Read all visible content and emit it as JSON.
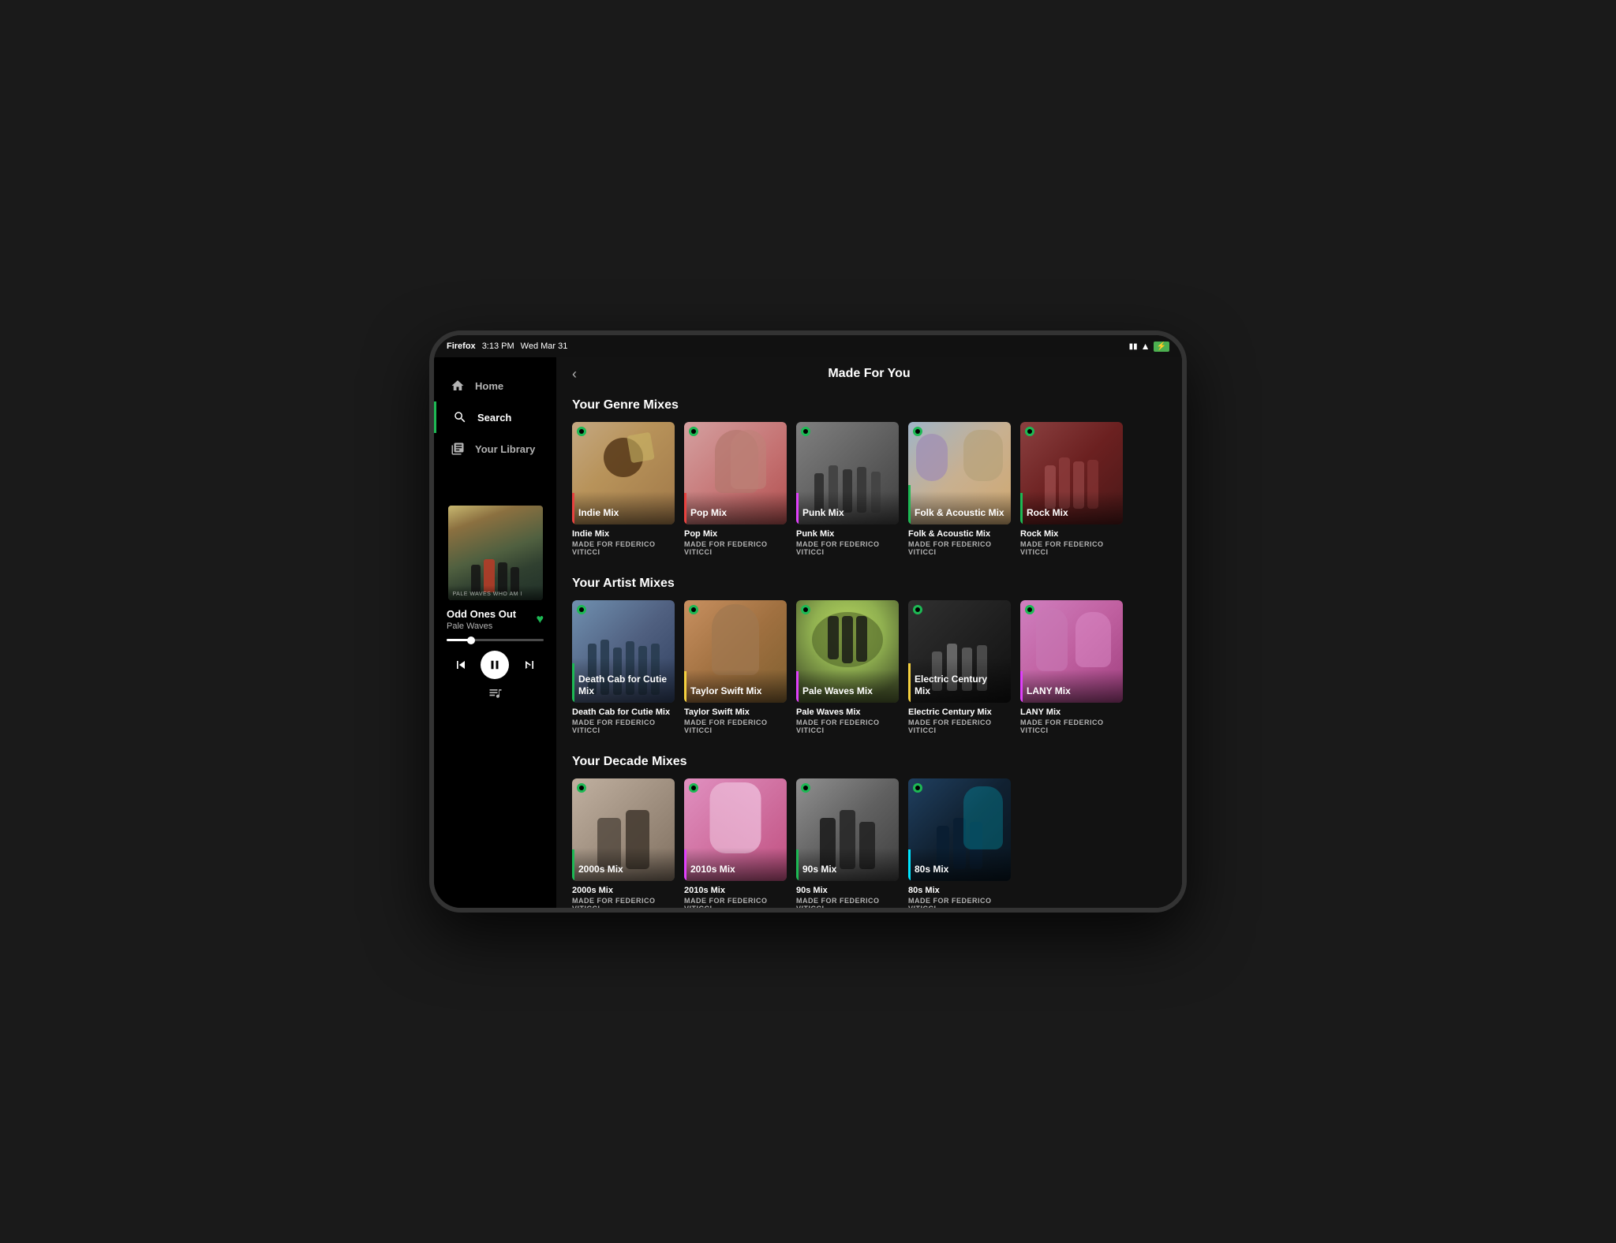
{
  "statusBar": {
    "browser": "Firefox",
    "time": "3:13 PM",
    "date": "Wed Mar 31"
  },
  "nav": {
    "home": "Home",
    "search": "Search",
    "yourLibrary": "Your Library"
  },
  "player": {
    "trackName": "Odd Ones Out",
    "artist": "Pale Waves",
    "albumLabel": "PALE WAVES WHO AM I",
    "progress": 25
  },
  "pageTitle": "Made For You",
  "sections": [
    {
      "id": "genre-mixes",
      "title": "Your Genre Mixes",
      "cards": [
        {
          "id": "indie-mix",
          "label": "Indie Mix",
          "title": "Indie Mix",
          "subtitle": "MADE FOR FEDERICO VITICCI",
          "accentColor": "#e8423f",
          "bg1": "#c4a882",
          "bg2": "#b8935a"
        },
        {
          "id": "pop-mix",
          "label": "Pop Mix",
          "title": "Pop Mix",
          "subtitle": "MADE FOR FEDERICO VITICCI",
          "accentColor": "#e8423f",
          "bg1": "#d4a0a0",
          "bg2": "#c47070"
        },
        {
          "id": "punk-mix",
          "label": "Punk Mix",
          "title": "Punk Mix",
          "subtitle": "MADE FOR FEDERICO VITICCI",
          "accentColor": "#e040fb",
          "bg1": "#808080",
          "bg2": "#606060"
        },
        {
          "id": "folk-mix",
          "label": "Folk & Acoustic Mix",
          "title": "Folk & Acoustic Mix",
          "subtitle": "MADE FOR FEDERICO VITICCI",
          "accentColor": "#1db954",
          "bg1": "#a0b4c8",
          "bg2": "#c8b090"
        },
        {
          "id": "rock-mix",
          "label": "Rock Mix",
          "title": "Rock Mix",
          "subtitle": "MADE FOR FEDERICO VITICCI",
          "accentColor": "#1db954",
          "bg1": "#8b4040",
          "bg2": "#6b2020"
        }
      ]
    },
    {
      "id": "artist-mixes",
      "title": "Your Artist Mixes",
      "cards": [
        {
          "id": "dcfc-mix",
          "label": "Death Cab for Cutie Mix",
          "title": "Death Cab for Cutie Mix",
          "subtitle": "MADE FOR FEDERICO VITICCI",
          "accentColor": "#1db954",
          "bg1": "#7090b0",
          "bg2": "#506080"
        },
        {
          "id": "swift-mix",
          "label": "Taylor Swift Mix",
          "title": "Taylor Swift Mix",
          "subtitle": "MADE FOR FEDERICO VITICCI",
          "accentColor": "#f4d03f",
          "bg1": "#c89060",
          "bg2": "#a07040"
        },
        {
          "id": "pale-waves-mix",
          "label": "Pale Waves Mix",
          "title": "Pale Waves Mix",
          "subtitle": "MADE FOR FEDERICO VITICCI",
          "accentColor": "#e040fb",
          "bg1": "#90b050",
          "bg2": "#506030"
        },
        {
          "id": "electric-century-mix",
          "label": "Electric Century Mix",
          "title": "Electric Century Mix",
          "subtitle": "MADE FOR FEDERICO VITICCI",
          "accentColor": "#f4d03f",
          "bg1": "#303030",
          "bg2": "#202020"
        },
        {
          "id": "lany-mix",
          "label": "LANY Mix",
          "title": "LANY Mix",
          "subtitle": "MADE FOR FEDERICO VITICCI",
          "accentColor": "#e040fb",
          "bg1": "#d080c0",
          "bg2": "#c060a0"
        }
      ]
    },
    {
      "id": "decade-mixes",
      "title": "Your Decade Mixes",
      "cards": [
        {
          "id": "2000s-mix",
          "label": "2000s Mix",
          "title": "2000s Mix",
          "subtitle": "MADE FOR FEDERICO VITICCI",
          "accentColor": "#1db954",
          "bg1": "#c0b0a0",
          "bg2": "#a09080"
        },
        {
          "id": "2010s-mix",
          "label": "2010s Mix",
          "title": "2010s Mix",
          "subtitle": "MADE FOR FEDERICO VITICCI",
          "accentColor": "#e040fb",
          "bg1": "#e090c0",
          "bg2": "#d070a0"
        },
        {
          "id": "90s-mix",
          "label": "90s Mix",
          "title": "90s Mix",
          "subtitle": "MADE FOR FEDERICO VITICCI",
          "accentColor": "#1db954",
          "bg1": "#909090",
          "bg2": "#606060"
        },
        {
          "id": "80s-mix",
          "label": "80s Mix",
          "title": "80s Mix",
          "subtitle": "MADE FOR FEDERICO VITICCI",
          "accentColor": "#00e5ff",
          "bg1": "#204060",
          "bg2": "#102030"
        }
      ]
    }
  ]
}
